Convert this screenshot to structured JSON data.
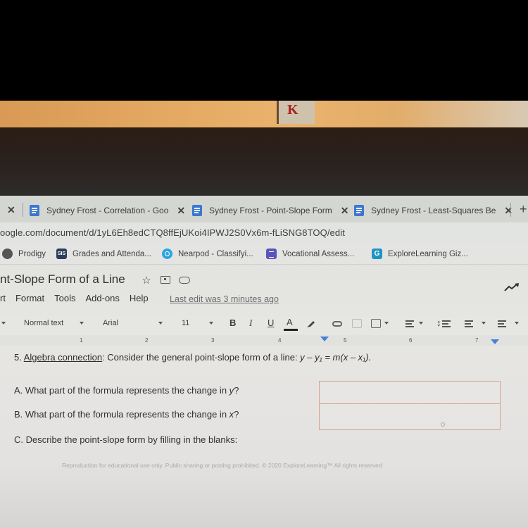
{
  "browser": {
    "tabs": [
      {
        "title": "Sydney Frost - Correlation - Goo",
        "close": "✕"
      },
      {
        "title": "Sydney Frost - Point-Slope Form",
        "close": "✕"
      },
      {
        "title": "Sydney Frost - Least-Squares Be",
        "close": "✕"
      }
    ],
    "leftmost_close": "✕",
    "new_tab": "+",
    "url": "oogle.com/document/d/1yL6Eh8edCTQ8ffEjUKoi4IPWJ2S0Vx6m-fLiSNG8TOQ/edit",
    "bookmarks": [
      {
        "label": "Prodigy",
        "icon": "globe-icon"
      },
      {
        "label": "Grades and Attenda...",
        "icon": "sis-icon",
        "icon_text": "SIS"
      },
      {
        "label": "Nearpod - Classifyi...",
        "icon": "nearpod-icon"
      },
      {
        "label": "Vocational Assess...",
        "icon": "forms-icon"
      },
      {
        "label": "ExploreLearning Giz...",
        "icon": "gizmos-icon",
        "icon_text": "G"
      }
    ]
  },
  "docs": {
    "title": "nt-Slope Form of a Line",
    "title_icons": [
      "star-icon",
      "move-to-folder-icon",
      "cloud-status-icon"
    ],
    "star_glyph": "☆",
    "menu": [
      "rt",
      "Format",
      "Tools",
      "Add-ons",
      "Help"
    ],
    "last_edit": "Last edit was 3 minutes ago",
    "toolbar": {
      "style": "Normal text",
      "font": "Arial",
      "size": "11",
      "bold": "B",
      "italic": "I",
      "underline": "U",
      "text_color": "A",
      "text_color_value": "#222222"
    },
    "ruler": [
      "1",
      "2",
      "3",
      "4",
      "5",
      "6",
      "7"
    ]
  },
  "document": {
    "question": {
      "number": "5.",
      "link": "Algebra connection",
      "text": ": Consider the general point-slope form of a line: ",
      "formula": "y – y₁ = m(x – x₁)."
    },
    "sub_questions": [
      {
        "label": "A. What part of the formula represents the change in ",
        "var": "y",
        "end": "?"
      },
      {
        "label": "B. What part of the formula represents the change in ",
        "var": "x",
        "end": "?"
      },
      {
        "label": "C. Describe the point-slope form by filling in the blanks:",
        "var": "",
        "end": ""
      }
    ],
    "answers": [
      "",
      ""
    ],
    "footer": "Reproduction for educational use only. Public sharing or posting prohibited. © 2020 ExploreLearning™ All rights reserved"
  },
  "colors": {
    "docs_blue": "#3b77cf",
    "answer_border": "#d9a487",
    "indent_marker": "#4a7fd6"
  }
}
